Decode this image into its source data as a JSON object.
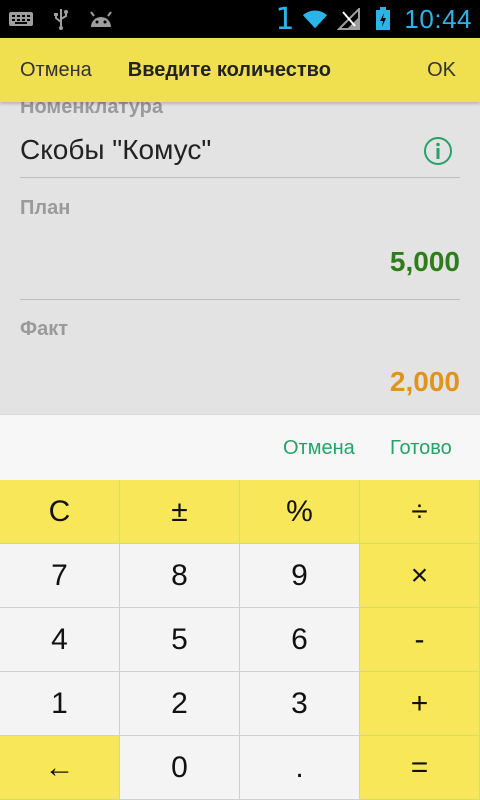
{
  "status_bar": {
    "sim_number": "1",
    "time": "10:44",
    "icons": [
      "keyboard-icon",
      "usb-icon",
      "android-icon",
      "wifi-icon",
      "signal-icon",
      "battery-icon"
    ]
  },
  "header": {
    "cancel_label": "Отмена",
    "title": "Введите количество",
    "ok_label": "OK"
  },
  "form": {
    "nomenclature_label": "Номенклатура",
    "nomenclature_value": "Скобы \"Комус\"",
    "info_icon": "info-icon",
    "plan_label": "План",
    "plan_value": "5,000",
    "fact_label": "Факт",
    "fact_value": "2,000"
  },
  "actions": {
    "cancel_label": "Отмена",
    "done_label": "Готово"
  },
  "keypad": {
    "keys": [
      "C",
      "±",
      "%",
      "÷",
      "7",
      "8",
      "9",
      "×",
      "4",
      "5",
      "6",
      "-",
      "1",
      "2",
      "3",
      "+",
      "←",
      "0",
      ".",
      "="
    ]
  },
  "colors": {
    "header_bg": "#f0e050",
    "key_yellow": "#f8e758",
    "plan_value": "#2e7d1a",
    "fact_value": "#e0941c",
    "action_text": "#26a269"
  }
}
